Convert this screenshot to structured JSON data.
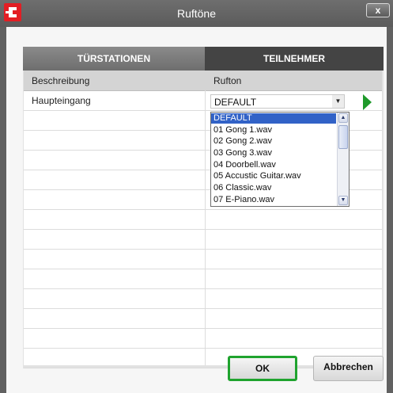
{
  "window": {
    "title": "Ruftöne",
    "close_label": "x"
  },
  "tabs": [
    {
      "label": "TÜRSTATIONEN",
      "active": false
    },
    {
      "label": "TEILNEHMER",
      "active": true
    }
  ],
  "table": {
    "headers": {
      "description": "Beschreibung",
      "ringtone": "Rufton"
    },
    "rows": [
      {
        "description": "Haupteingang",
        "ringtone": "DEFAULT"
      }
    ]
  },
  "ringtone_dropdown": {
    "selected": "DEFAULT",
    "options": [
      "DEFAULT",
      "01 Gong 1.wav",
      "02 Gong 2.wav",
      "03 Gong 3.wav",
      "04 Doorbell.wav",
      "05 Accustic Guitar.wav",
      "06 Classic.wav",
      "07 E-Piano.wav"
    ]
  },
  "buttons": {
    "ok": "OK",
    "cancel": "Abbrechen"
  },
  "icons": {
    "app": "doorbell-app-icon",
    "play": "play-icon",
    "close": "close-icon"
  },
  "colors": {
    "accent_green": "#1fa32e",
    "selection_blue": "#3162c7",
    "titlebar": "#616161",
    "active_tab": "#444444"
  }
}
